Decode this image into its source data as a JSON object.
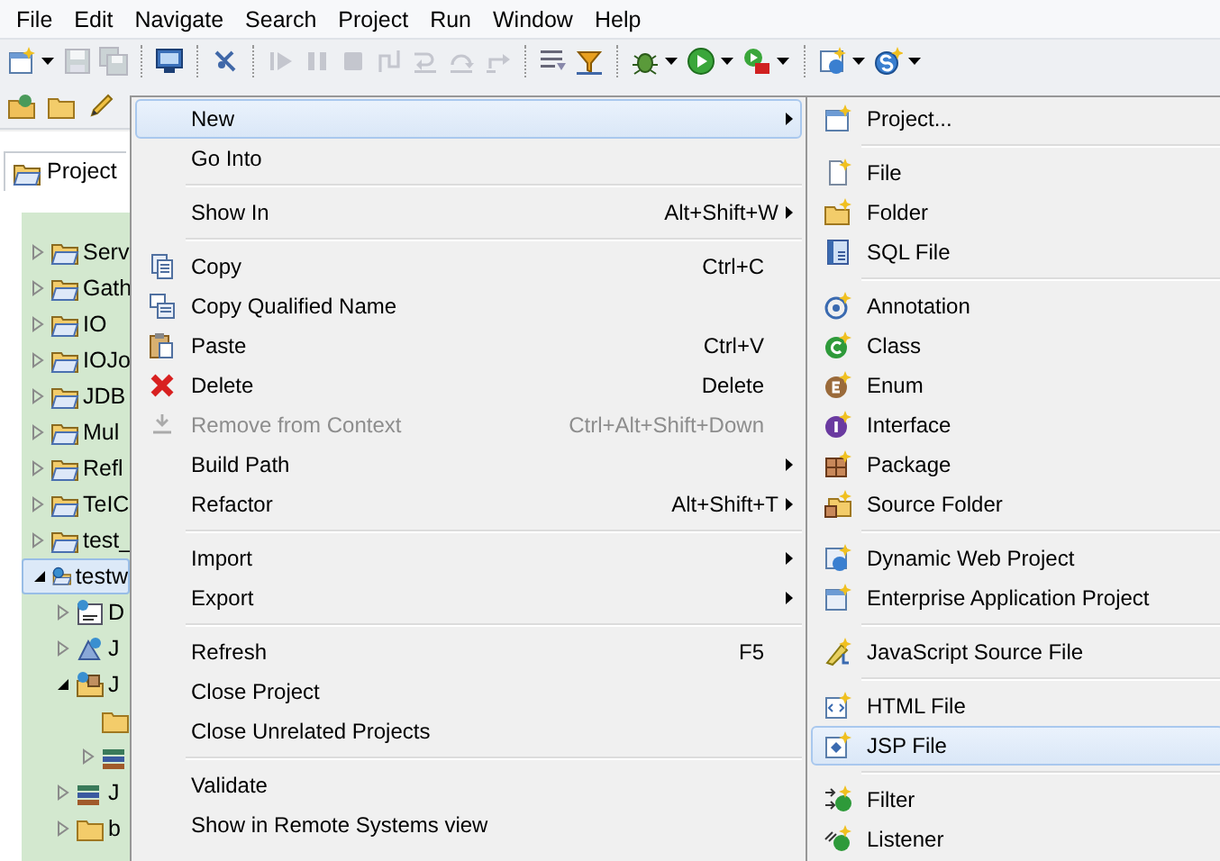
{
  "menubar": [
    {
      "label": "File"
    },
    {
      "label": "Edit"
    },
    {
      "label": "Navigate"
    },
    {
      "label": "Search"
    },
    {
      "label": "Project"
    },
    {
      "label": "Run"
    },
    {
      "label": "Window"
    },
    {
      "label": "Help"
    }
  ],
  "toolbar": [
    {
      "kind": "button",
      "disabled": false,
      "dropdown": true
    },
    {
      "kind": "button",
      "disabled": true,
      "dropdown": false
    },
    {
      "kind": "button",
      "disabled": true,
      "dropdown": false
    },
    {
      "kind": "separator"
    },
    {
      "kind": "button",
      "disabled": false,
      "dropdown": false
    },
    {
      "kind": "separator"
    },
    {
      "kind": "button",
      "disabled": false,
      "dropdown": false
    },
    {
      "kind": "separator"
    },
    {
      "kind": "button",
      "disabled": true,
      "dropdown": false
    },
    {
      "kind": "button",
      "disabled": true,
      "dropdown": false
    },
    {
      "kind": "button",
      "disabled": true,
      "dropdown": false
    },
    {
      "kind": "button",
      "disabled": true,
      "dropdown": false
    },
    {
      "kind": "button",
      "disabled": true,
      "dropdown": false
    },
    {
      "kind": "button",
      "disabled": true,
      "dropdown": false
    },
    {
      "kind": "button",
      "disabled": true,
      "dropdown": false
    },
    {
      "kind": "separator"
    },
    {
      "kind": "button",
      "disabled": false,
      "dropdown": false
    },
    {
      "kind": "button",
      "disabled": false,
      "dropdown": false
    },
    {
      "kind": "separator"
    },
    {
      "kind": "button",
      "disabled": false,
      "dropdown": true
    },
    {
      "kind": "button",
      "disabled": false,
      "dropdown": true
    },
    {
      "kind": "button",
      "disabled": false,
      "dropdown": true
    },
    {
      "kind": "separator"
    },
    {
      "kind": "button",
      "disabled": false,
      "dropdown": true
    },
    {
      "kind": "button",
      "disabled": false,
      "dropdown": true
    }
  ],
  "toolbar_2": [
    {
      "kind": "button"
    },
    {
      "kind": "button"
    },
    {
      "kind": "button"
    }
  ],
  "view_tab": {
    "label": "Project"
  },
  "tree": [
    {
      "label": "Serv",
      "expanded": false,
      "selected": false
    },
    {
      "label": "Gath",
      "expanded": false,
      "selected": false
    },
    {
      "label": "IO",
      "expanded": false,
      "selected": false
    },
    {
      "label": "IOJo",
      "expanded": false,
      "selected": false
    },
    {
      "label": "JDB",
      "expanded": false,
      "selected": false
    },
    {
      "label": "Mul",
      "expanded": false,
      "selected": false
    },
    {
      "label": "Refl",
      "expanded": false,
      "selected": false
    },
    {
      "label": "TeIC",
      "expanded": false,
      "selected": false
    },
    {
      "label": "test_",
      "expanded": false,
      "selected": false
    },
    {
      "label": "testw",
      "expanded": true,
      "selected": true,
      "children": [
        {
          "label": "D",
          "expanded": false,
          "selected": false
        },
        {
          "label": "J",
          "expanded": false,
          "selected": false
        },
        {
          "label": "J",
          "expanded": true,
          "selected": false,
          "children": [
            {
              "selected": false
            },
            {
              "expanded": false,
              "selected": false
            }
          ]
        },
        {
          "label": "J",
          "expanded": false,
          "selected": false
        },
        {
          "label": "b",
          "expanded": false,
          "selected": false
        }
      ]
    }
  ],
  "context_menu": [
    {
      "kind": "item",
      "label": "New",
      "submenu": true,
      "selected": true,
      "disabled": false
    },
    {
      "kind": "item",
      "label": "Go Into",
      "submenu": false,
      "selected": false,
      "disabled": false
    },
    {
      "kind": "separator"
    },
    {
      "kind": "item",
      "label": "Show In",
      "shortcut": "Alt+Shift+W",
      "submenu": true,
      "selected": false,
      "disabled": false
    },
    {
      "kind": "separator"
    },
    {
      "kind": "item",
      "label": "Copy",
      "shortcut": "Ctrl+C",
      "submenu": false,
      "selected": false,
      "disabled": false
    },
    {
      "kind": "item",
      "label": "Copy Qualified Name",
      "submenu": false,
      "selected": false,
      "disabled": false
    },
    {
      "kind": "item",
      "label": "Paste",
      "shortcut": "Ctrl+V",
      "submenu": false,
      "selected": false,
      "disabled": false
    },
    {
      "kind": "item",
      "label": "Delete",
      "shortcut": "Delete",
      "submenu": false,
      "selected": false,
      "disabled": false
    },
    {
      "kind": "item",
      "label": "Remove from Context",
      "shortcut": "Ctrl+Alt+Shift+Down",
      "submenu": false,
      "selected": false,
      "disabled": true
    },
    {
      "kind": "item",
      "label": "Build Path",
      "submenu": true,
      "selected": false,
      "disabled": false
    },
    {
      "kind": "item",
      "label": "Refactor",
      "shortcut": "Alt+Shift+T",
      "submenu": true,
      "selected": false,
      "disabled": false
    },
    {
      "kind": "separator"
    },
    {
      "kind": "item",
      "label": "Import",
      "submenu": true,
      "selected": false,
      "disabled": false
    },
    {
      "kind": "item",
      "label": "Export",
      "submenu": true,
      "selected": false,
      "disabled": false
    },
    {
      "kind": "separator"
    },
    {
      "kind": "item",
      "label": "Refresh",
      "shortcut": "F5",
      "submenu": false,
      "selected": false,
      "disabled": false
    },
    {
      "kind": "item",
      "label": "Close Project",
      "submenu": false,
      "selected": false,
      "disabled": false
    },
    {
      "kind": "item",
      "label": "Close Unrelated Projects",
      "submenu": false,
      "selected": false,
      "disabled": false
    },
    {
      "kind": "separator"
    },
    {
      "kind": "item",
      "label": "Validate",
      "submenu": false,
      "selected": false,
      "disabled": false
    },
    {
      "kind": "item",
      "label": "Show in Remote Systems view",
      "submenu": false,
      "selected": false,
      "disabled": false
    }
  ],
  "new_submenu": [
    {
      "kind": "item",
      "label": "Project...",
      "selected": false
    },
    {
      "kind": "separator"
    },
    {
      "kind": "item",
      "label": "File",
      "selected": false
    },
    {
      "kind": "item",
      "label": "Folder",
      "selected": false
    },
    {
      "kind": "item",
      "label": "SQL File",
      "selected": false
    },
    {
      "kind": "separator"
    },
    {
      "kind": "item",
      "label": "Annotation",
      "selected": false
    },
    {
      "kind": "item",
      "label": "Class",
      "selected": false
    },
    {
      "kind": "item",
      "label": "Enum",
      "selected": false
    },
    {
      "kind": "item",
      "label": "Interface",
      "selected": false
    },
    {
      "kind": "item",
      "label": "Package",
      "selected": false
    },
    {
      "kind": "item",
      "label": "Source Folder",
      "selected": false
    },
    {
      "kind": "separator"
    },
    {
      "kind": "item",
      "label": "Dynamic Web Project",
      "selected": false
    },
    {
      "kind": "item",
      "label": "Enterprise Application Project",
      "selected": false
    },
    {
      "kind": "separator"
    },
    {
      "kind": "item",
      "label": "JavaScript Source File",
      "selected": false
    },
    {
      "kind": "separator"
    },
    {
      "kind": "item",
      "label": "HTML File",
      "selected": false
    },
    {
      "kind": "item",
      "label": "JSP File",
      "selected": true
    },
    {
      "kind": "separator"
    },
    {
      "kind": "item",
      "label": "Filter",
      "selected": false
    },
    {
      "kind": "item",
      "label": "Listener",
      "selected": false
    }
  ]
}
